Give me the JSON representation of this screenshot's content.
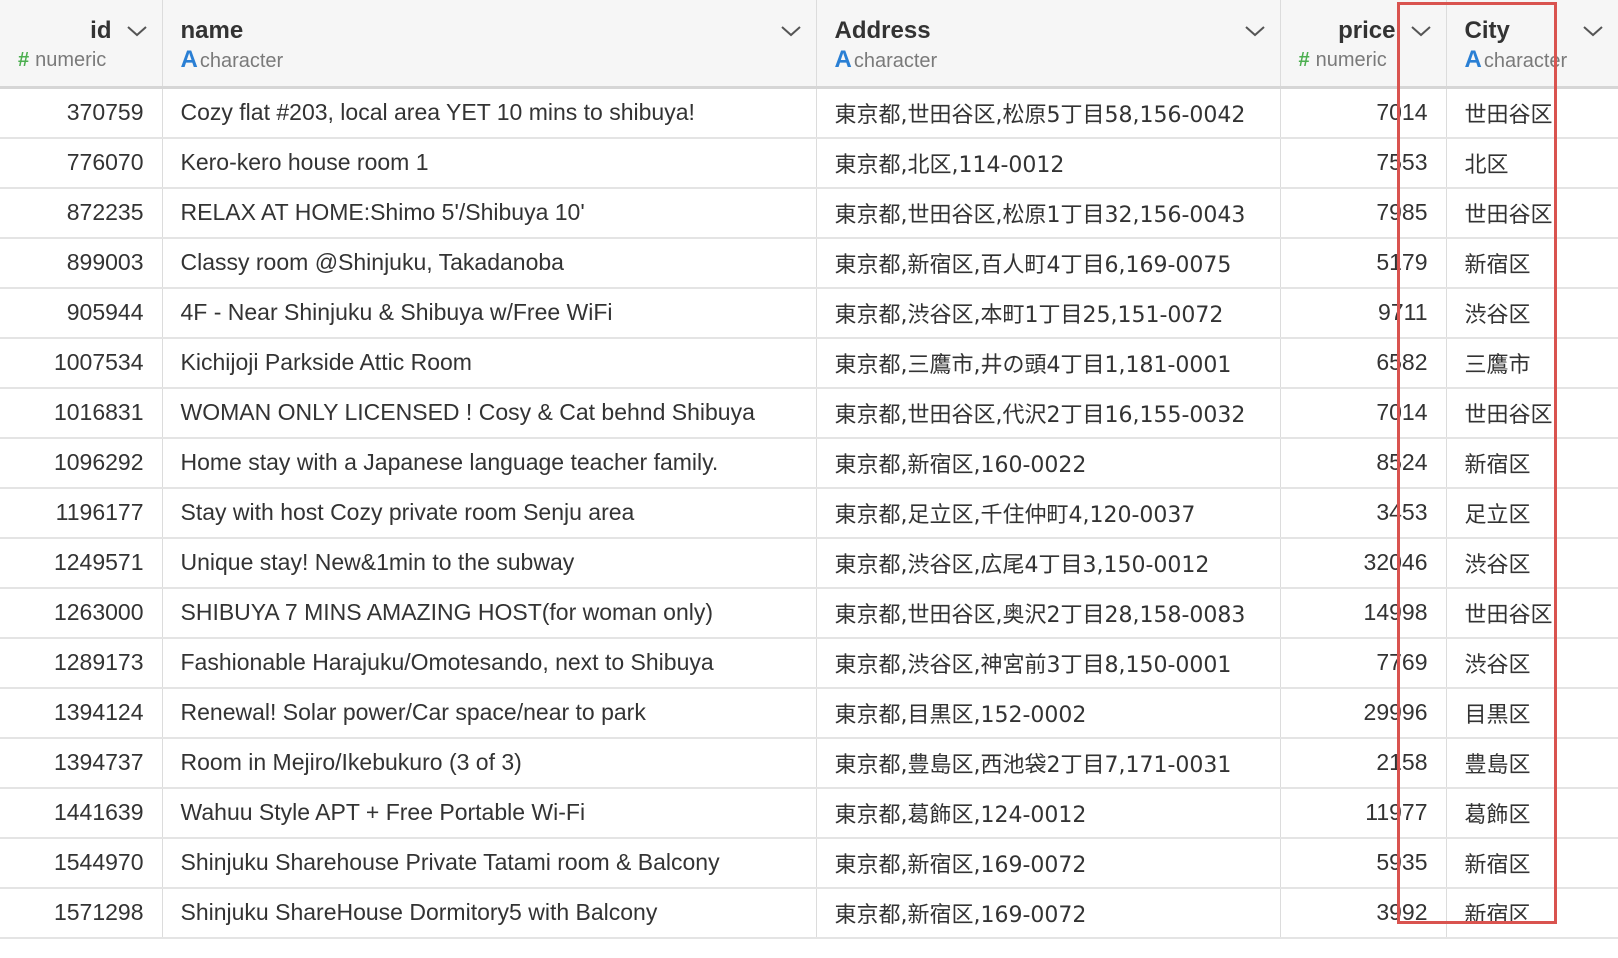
{
  "columns": [
    {
      "key": "id",
      "title": "id",
      "type_glyph": "#",
      "type_label": "numeric",
      "align": "right"
    },
    {
      "key": "name",
      "title": "name",
      "type_glyph": "A",
      "type_label": "character",
      "align": "left"
    },
    {
      "key": "address",
      "title": "Address",
      "type_glyph": "A",
      "type_label": "character",
      "align": "left"
    },
    {
      "key": "price",
      "title": "price",
      "type_glyph": "#",
      "type_label": "numeric",
      "align": "right"
    },
    {
      "key": "city",
      "title": "City",
      "type_glyph": "A",
      "type_label": "character",
      "align": "left"
    }
  ],
  "rows": [
    {
      "id": "370759",
      "name": "Cozy flat #203, local area YET 10 mins to shibuya!",
      "address": "東京都,世田谷区,松原5丁目58,156-0042",
      "price": "7014",
      "city": "世田谷区"
    },
    {
      "id": "776070",
      "name": "Kero-kero house room 1",
      "address": "東京都,北区,114-0012",
      "price": "7553",
      "city": "北区"
    },
    {
      "id": "872235",
      "name": "RELAX AT HOME:Shimo 5'/Shibuya 10'",
      "address": "東京都,世田谷区,松原1丁目32,156-0043",
      "price": "7985",
      "city": "世田谷区"
    },
    {
      "id": "899003",
      "name": "Classy room @Shinjuku, Takadanoba",
      "address": "東京都,新宿区,百人町4丁目6,169-0075",
      "price": "5179",
      "city": "新宿区"
    },
    {
      "id": "905944",
      "name": "4F - Near Shinjuku & Shibuya w/Free WiFi",
      "address": "東京都,渋谷区,本町1丁目25,151-0072",
      "price": "9711",
      "city": "渋谷区"
    },
    {
      "id": "1007534",
      "name": "Kichijoji Parkside Attic Room",
      "address": "東京都,三鷹市,井の頭4丁目1,181-0001",
      "price": "6582",
      "city": "三鷹市"
    },
    {
      "id": "1016831",
      "name": "WOMAN ONLY LICENSED ! Cosy & Cat behnd Shibuya",
      "address": "東京都,世田谷区,代沢2丁目16,155-0032",
      "price": "7014",
      "city": "世田谷区"
    },
    {
      "id": "1096292",
      "name": "Home stay with a Japanese language teacher family.",
      "address": "東京都,新宿区,160-0022",
      "price": "8524",
      "city": "新宿区"
    },
    {
      "id": "1196177",
      "name": "Stay with host Cozy private room Senju area",
      "address": "東京都,足立区,千住仲町4,120-0037",
      "price": "3453",
      "city": "足立区"
    },
    {
      "id": "1249571",
      "name": "Unique stay! New&1min to the subway",
      "address": "東京都,渋谷区,広尾4丁目3,150-0012",
      "price": "32046",
      "city": "渋谷区"
    },
    {
      "id": "1263000",
      "name": "SHIBUYA 7 MINS AMAZING HOST(for woman only)",
      "address": "東京都,世田谷区,奥沢2丁目28,158-0083",
      "price": "14998",
      "city": "世田谷区"
    },
    {
      "id": "1289173",
      "name": "Fashionable Harajuku/Omotesando, next to Shibuya",
      "address": "東京都,渋谷区,神宮前3丁目8,150-0001",
      "price": "7769",
      "city": "渋谷区"
    },
    {
      "id": "1394124",
      "name": "Renewal! Solar power/Car space/near to park",
      "address": "東京都,目黒区,152-0002",
      "price": "29996",
      "city": "目黒区"
    },
    {
      "id": "1394737",
      "name": "Room in Mejiro/Ikebukuro (3 of 3)",
      "address": "東京都,豊島区,西池袋2丁目7,171-0031",
      "price": "2158",
      "city": "豊島区"
    },
    {
      "id": "1441639",
      "name": "Wahuu Style APT + Free Portable Wi-Fi",
      "address": "東京都,葛飾区,124-0012",
      "price": "11977",
      "city": "葛飾区"
    },
    {
      "id": "1544970",
      "name": "Shinjuku Sharehouse Private Tatami room & Balcony",
      "address": "東京都,新宿区,169-0072",
      "price": "5935",
      "city": "新宿区"
    },
    {
      "id": "1571298",
      "name": "Shinjuku ShareHouse Dormitory5 with Balcony",
      "address": "東京都,新宿区,169-0072",
      "price": "3992",
      "city": "新宿区"
    }
  ],
  "highlight": {
    "column": "city",
    "color": "#d9534f"
  },
  "colors": {
    "numeric_glyph": "#4caf50",
    "character_glyph": "#2a7fd4"
  }
}
